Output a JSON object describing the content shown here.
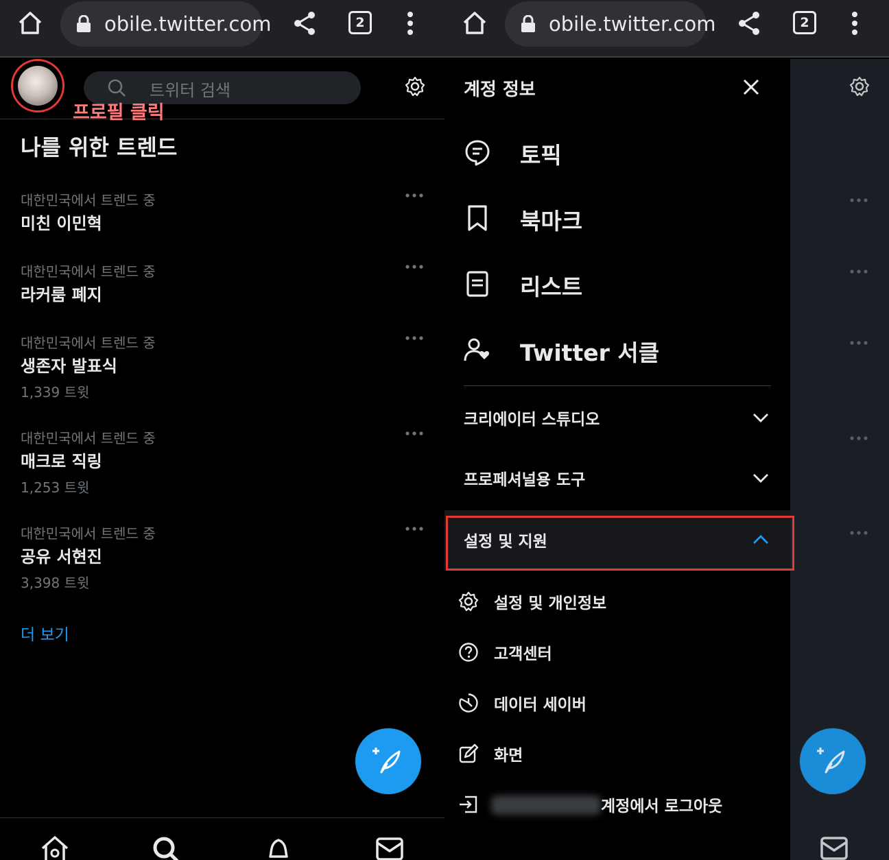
{
  "browser": {
    "url": "obile.twitter.com",
    "tab_count": "2"
  },
  "left": {
    "search_placeholder": "트위터 검색",
    "annotation": "프로필 클릭",
    "trends_title": "나를 위한 트렌드",
    "trends": [
      {
        "context": "대한민국에서 트렌드 중",
        "name": "미친 이민혁",
        "count": ""
      },
      {
        "context": "대한민국에서 트렌드 중",
        "name": "라커룸 폐지",
        "count": ""
      },
      {
        "context": "대한민국에서 트렌드 중",
        "name": "생존자 발표식",
        "count": "1,339 트윗"
      },
      {
        "context": "대한민국에서 트렌드 중",
        "name": "매크로 직링",
        "count": "1,253 트윗"
      },
      {
        "context": "대한민국에서 트렌드 중",
        "name": "공유 서현진",
        "count": "3,398 트윗"
      }
    ],
    "more_label": "더 보기"
  },
  "drawer": {
    "title": "계정 정보",
    "items": [
      {
        "label": "토픽",
        "icon": "topics-icon"
      },
      {
        "label": "북마크",
        "icon": "bookmark-icon"
      },
      {
        "label": "리스트",
        "icon": "list-icon"
      },
      {
        "label": "Twitter 서클",
        "icon": "circle-icon"
      }
    ],
    "sections": [
      {
        "label": "크리에이터 스튜디오",
        "expanded": false
      },
      {
        "label": "프로페셔널용 도구",
        "expanded": false
      },
      {
        "label": "설정 및 지원",
        "expanded": true
      }
    ],
    "sub_items": [
      {
        "label": "설정 및 개인정보",
        "icon": "gear-icon"
      },
      {
        "label": "고객센터",
        "icon": "help-icon"
      },
      {
        "label": "데이터 세이버",
        "icon": "data-saver-icon"
      },
      {
        "label": "화면",
        "icon": "display-icon"
      },
      {
        "label": "계정에서 로그아웃",
        "icon": "logout-icon"
      }
    ]
  },
  "colors": {
    "accent": "#1d9bf0",
    "annotation_red": "#e53935",
    "background": "#000000",
    "secondary_text": "#71767b"
  }
}
